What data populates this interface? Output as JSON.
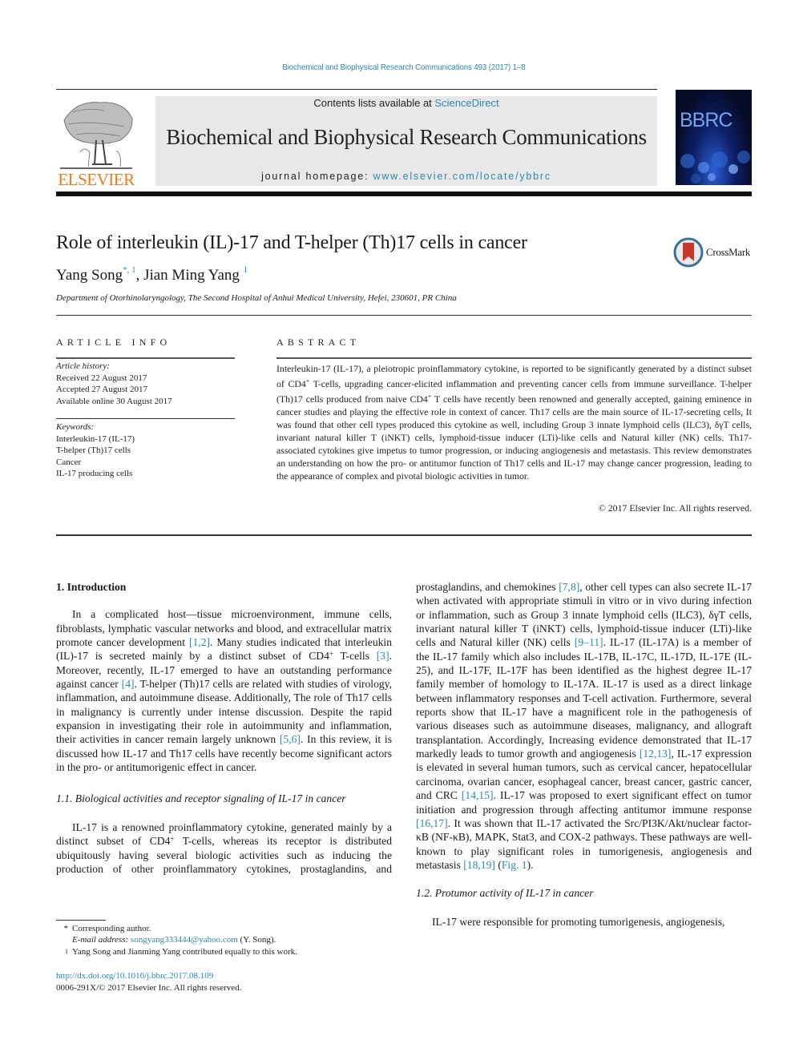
{
  "header": {
    "running_head": "Biochemical and Biophysical Research Communications 493 (2017) 1–8",
    "contents_prefix": "Contents lists available at ",
    "contents_link": "ScienceDirect",
    "journal_title": "Biochemical and Biophysical Research Communications",
    "homepage_prefix": "journal homepage: ",
    "homepage_link": "www.elsevier.com/locate/ybbrc",
    "publisher_logo": "ELSEVIER",
    "cover_title": "BBRC",
    "crossmark_label": "CrossMark",
    "colors": {
      "link": "#2a8ab4",
      "elsevier_orange": "#f07a1a"
    }
  },
  "article": {
    "title": "Role of interleukin (IL)-17 and T-helper (Th)17 cells in cancer",
    "authors": [
      {
        "name": "Yang Song",
        "marks": "*, 1"
      },
      {
        "name": "Jian Ming Yang",
        "marks": "1"
      }
    ],
    "author_separator": ", ",
    "affiliation": "Department of Otorhinolaryngology, The Second Hospital of Anhui Medical University, Hefei, 230601, PR China"
  },
  "article_info": {
    "label": "ARTICLE INFO",
    "history_label": "Article history:",
    "history": [
      "Received 22 August 2017",
      "Accepted 27 August 2017",
      "Available online 30 August 2017"
    ],
    "keywords_label": "Keywords:",
    "keywords": [
      "Interleukin-17 (IL-17)",
      "T-helper (Th)17 cells",
      "Cancer",
      "IL-17 producing cells"
    ]
  },
  "abstract": {
    "label": "ABSTRACT",
    "text_parts": [
      "Interleukin-17 (IL-17), a pleiotropic proinflammatory cytokine, is reported to be significantly generated by a distinct subset of CD4",
      "+",
      " T-cells, upgrading cancer-elicited inflammation and preventing cancer cells from immune surveillance. T-helper (Th)17 cells produced from naive CD4",
      "+",
      " T cells have recently been renowned and generally accepted, gaining eminence in cancer studies and playing the effective role in context of cancer. Th17 cells are the main source of IL-17-secreting cells, It was found that other cell types produced this cytokine as well, including Group 3 innate lymphoid cells (ILC3), δγT cells, invariant natural killer T (iNKT) cells, lymphoid-tissue inducer (LTi)-like cells and Natural killer (NK) cells. Th17-associated cytokines give impetus to tumor progression, or inducing angiogenesis and metastasis. This review demonstrates an understanding on how the pro- or antitumor function of Th17 cells and IL-17 may change cancer progression, leading to the appearance of complex and pivotal biologic activities in tumor."
    ],
    "copyright": "© 2017 Elsevier Inc. All rights reserved."
  },
  "body": {
    "section1_heading": "1.  Introduction",
    "intro": {
      "t1": "In a complicated host—tissue microenvironment, immune cells, fibroblasts, lymphatic vascular networks and blood, and extracellular matrix promote cancer development ",
      "r1": "[1,2]",
      "t2": ". Many studies indicated that interleukin (IL)-17 is secreted mainly by a distinct subset of CD4",
      "sup1": "+",
      "t3": " T-cells ",
      "r2": "[3]",
      "t4": ". Moreover, recently, IL-17 emerged to have an outstanding performance against cancer ",
      "r3": "[4]",
      "t5": ". T-helper (Th)17 cells are related with studies of virology, inflammation, and autoimmune disease. Additionally, The role of Th17 cells in malignancy is currently under intense discussion. Despite the rapid expansion in investigating their role in autoimmunity and inflammation, their activities in cancer remain largely unknown ",
      "r4": "[5,6]",
      "t6": ". In this review, it is discussed how IL-17 and Th17 cells have recently become significant actors in the pro- or antitumorigenic effect in cancer."
    },
    "section11_heading": "1.1.  Biological activities and receptor signaling of IL-17 in cancer",
    "bio": {
      "t1": "IL-17 is a renowned proinflammatory cytokine, generated mainly by a distinct subset of CD4",
      "sup1": "+",
      "t2": " T-cells, whereas its receptor is distributed ubiquitously having several biologic activities such as inducing the production of other proinflammatory cytokines, prostaglandins, and chemokines ",
      "r1": "[7,8]",
      "t3": ", other cell types can also secrete IL-17 when activated with appropriate stimuli in vitro or in vivo during infection or inflammation, such as Group 3 innate lymphoid cells (ILC3), δγT cells, invariant natural killer T (iNKT) cells, lymphoid-tissue inducer (LTi)-like cells and Natural killer (NK) cells ",
      "r2": "[9–11]",
      "t4": ". IL-17 (IL-17A) is a member of the IL-17 family which also includes IL-17B, IL-17C, IL-17D, IL-17E (IL-25), and IL-17F, IL-17F has been identified as the highest degree IL-17 family member of homology to IL-17A. IL-17 is used as a direct linkage between inflammatory responses and T-cell activation. Furthermore, several reports show that IL-17 have a magnificent role in the pathogenesis of various diseases such as autoimmune diseases, malignancy, and allograft transplantation. Accordingly, Increasing evidence demonstrated that IL-17 markedly leads to tumor growth and angiogenesis ",
      "r3": "[12,13]",
      "t5": ", IL-17 expression is elevated in several human tumors, such as cervical cancer, hepatocellular carcinoma, ovarian cancer, esophageal cancer, breast cancer, gastric cancer, and CRC ",
      "r4": "[14,15]",
      "t6": ". IL-17 was proposed to exert significant effect on tumor initiation and progression through affecting antitumor immune response ",
      "r5": "[16,17]",
      "t7": ". It was shown that IL-17 activated the Src/PI3K/Akt/nuclear factor-κB (NF-κB), MAPK, Stat3, and COX-2 pathways. These pathways are well-known to play significant roles in tumorigenesis, angiogenesis and metastasis ",
      "r6": "[18,19]",
      "t8": " (",
      "fig": "Fig. 1",
      "t9": ")."
    },
    "section12_heading": "1.2.  Protumor activity of IL-17 in cancer",
    "protumor_start": "IL-17 were responsible for promoting tumorigenesis, angiogenesis,"
  },
  "footnotes": {
    "corresponding_mark": "*",
    "corresponding": "Corresponding author.",
    "email_label": "E-mail address: ",
    "email": "songyang333444@yahoo.com",
    "email_suffix": " (Y. Song).",
    "equal_mark": "1",
    "equal": "Yang Song and Jianming Yang contributed equally to this work.",
    "doi": "http://dx.doi.org/10.1016/j.bbrc.2017.08.109",
    "issn": "0006-291X/© 2017 Elsevier Inc. All rights reserved."
  }
}
